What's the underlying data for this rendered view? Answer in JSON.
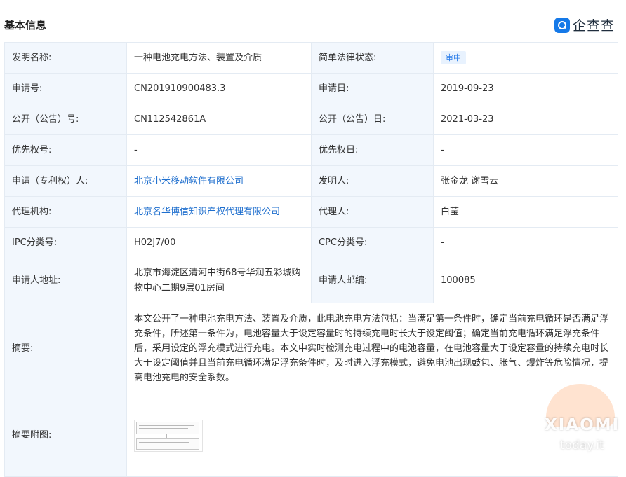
{
  "header": {
    "title": "基本信息",
    "logo_text": "企查查"
  },
  "labels": {
    "invention_name": "发明名称:",
    "legal_status": "简单法律状态:",
    "application_no": "申请号:",
    "application_date": "申请日:",
    "publication_no": "公开（公告）号:",
    "publication_date": "公开（公告）日:",
    "priority_no": "优先权号:",
    "priority_date": "优先权日:",
    "applicant": "申请（专利权）人:",
    "inventor": "发明人:",
    "agency": "代理机构:",
    "agent": "代理人:",
    "ipc": "IPC分类号:",
    "cpc": "CPC分类号:",
    "address": "申请人地址:",
    "postcode": "申请人邮编:",
    "abstract": "摘要:",
    "abstract_image": "摘要附图:"
  },
  "values": {
    "invention_name": "一种电池充电方法、装置及介质",
    "legal_status": "审中",
    "application_no": "CN201910900483.3",
    "application_date": "2019-09-23",
    "publication_no": "CN112542861A",
    "publication_date": "2021-03-23",
    "priority_no": "-",
    "priority_date": "-",
    "applicant": "北京小米移动软件有限公司",
    "inventor": "张金龙 谢雪云",
    "agency": "北京名华博信知识产权代理有限公司",
    "agent": "白莹",
    "ipc": "H02J7/00",
    "cpc": "-",
    "address": "北京市海淀区清河中街68号华润五彩城购物中心二期9层01房间",
    "postcode": "100085",
    "abstract": "本文公开了一种电池充电方法、装置及介质，此电池充电方法包括：当满足第一条件时，确定当前充电循环是否满足浮充条件，所述第一条件为，电池容量大于设定容量时的持续充电时长大于设定阈值；确定当前充电循环满足浮充条件后，采用设定的浮充模式进行充电。本文中实时检测充电过程中的电池容量，在电池容量大于设定容量的持续充电时长大于设定阈值并且当前充电循环满足浮充条件时，及时进入浮充模式，避免电池出现鼓包、胀气、爆炸等危险情况，提高电池充电的安全系数。"
  },
  "watermark": {
    "word": "XIAOMI",
    "domain": "today.it"
  },
  "colors": {
    "label_bg": "#f2f7fd",
    "border": "#e4ebf3",
    "link": "#1f6fce",
    "badge_bg": "#e8f2fe",
    "badge_text": "#2b7de9",
    "brand": "#1579e8"
  },
  "icons": {
    "logo": "qichacha-logo-icon",
    "abstract_figure": "flowchart-thumbnail-icon"
  }
}
